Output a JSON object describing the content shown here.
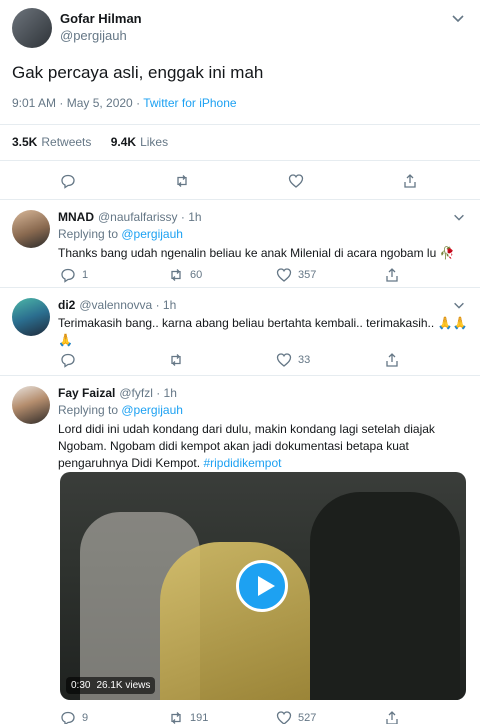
{
  "main_tweet": {
    "name": "Gofar Hilman",
    "handle": "@pergijauh",
    "text": "Gak percaya asli, enggak ini mah",
    "timestamp": "9:01 AM · May 5, 2020 · ",
    "source": "Twitter for iPhone",
    "retweets_count": "3.5K",
    "retweets_label": "Retweets",
    "likes_count": "9.4K",
    "likes_label": "Likes"
  },
  "replies": [
    {
      "name": "MNAD",
      "handle": "@naufalfarissy · 1h",
      "replying_prefix": "Replying to ",
      "replying_to": "@pergijauh",
      "text": "Thanks bang udah ngenalin beliau ke anak Milenial di acara ngobam lu 🥀",
      "reply_count": "1",
      "retweet_count": "60",
      "like_count": "357"
    },
    {
      "name": "di2",
      "handle": "@valennovva · 1h",
      "text_line1": "Terimakasih bang.. karna abang beliau bertahta kembali.. terimakasih.. 🙏🙏",
      "text_line2": "🙏",
      "reply_count": "",
      "retweet_count": "",
      "like_count": "33"
    },
    {
      "name": "Fay Faizal",
      "handle": "@fyfzl · 1h",
      "replying_prefix": "Replying to ",
      "replying_to": "@pergijauh",
      "text_line1": "Lord didi ini udah kondang dari dulu, makin kondang lagi setelah diajak",
      "text_line2": "Ngobam. Ngobam didi kempot akan jadi dokumentasi betapa kuat",
      "text_line3": "pengaruhnya Didi Kempot. ",
      "hashtag": "#ripdidikempot",
      "video_time": "0:30",
      "video_views": "26.1K views",
      "reply_count": "9",
      "retweet_count": "191",
      "like_count": "527"
    }
  ],
  "colors": {
    "accent": "#1da1f2",
    "muted": "#657786",
    "border": "#e6ecf0"
  }
}
